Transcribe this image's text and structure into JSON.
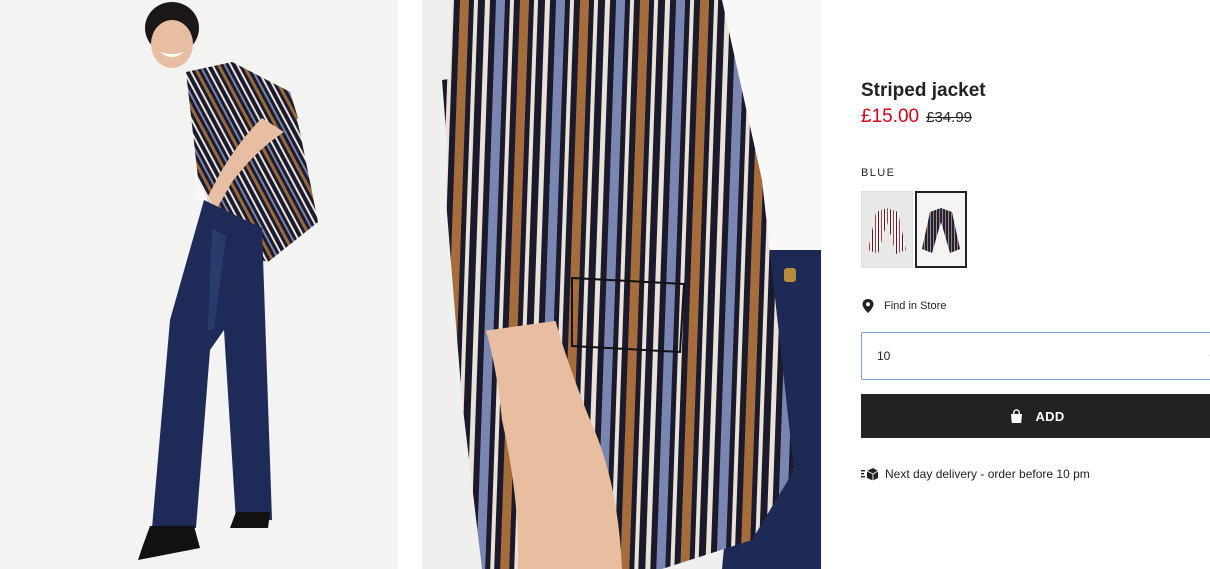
{
  "gallery": {
    "images": [
      {
        "alt": "model-wearing-striped-jacket-full-length"
      },
      {
        "alt": "striped-jacket-sleeve-close-up"
      }
    ]
  },
  "product": {
    "name": "Striped jacket",
    "price_now": "£15.00",
    "price_was": "£34.99",
    "sale_color": "#d6001c"
  },
  "color": {
    "selected_label": "BLUE",
    "options": [
      {
        "name": "white-striped"
      },
      {
        "name": "blue-striped",
        "selected": true
      }
    ]
  },
  "store": {
    "label": "Find in Store",
    "icon": "location-pin-icon"
  },
  "size_select": {
    "value": "10",
    "icon": "chevron-down-icon"
  },
  "add_button": {
    "label": "ADD",
    "icon": "shopping-bag-icon",
    "color": "#222222"
  },
  "delivery": {
    "text": "Next day delivery - order before 10 pm",
    "icon": "delivery-truck-icon"
  }
}
